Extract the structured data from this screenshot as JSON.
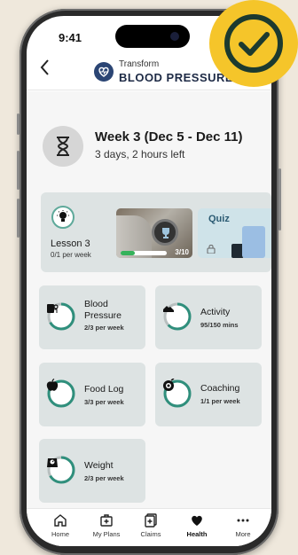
{
  "status_bar": {
    "time": "9:41"
  },
  "header": {
    "back_icon": "chevron-left-icon",
    "brand_small": "Transform",
    "brand_large": "BLOOD PRESSURE"
  },
  "week": {
    "title": "Week 3 (Dec 5 - Dec 11)",
    "subtitle": "3 days, 2 hours left",
    "icon": "hourglass-icon"
  },
  "lesson": {
    "title": "Lesson 3",
    "subtitle": "0/1 per week",
    "video_count": "3/10",
    "video_progress": 0.3,
    "quiz_label": "Quiz"
  },
  "tiles": [
    {
      "title": "Blood Pressure",
      "subtitle": "2/3 per week",
      "icon": "bp-cuff-icon",
      "progress": 0.67
    },
    {
      "title": "Activity",
      "subtitle": "95/150 mins",
      "icon": "sneaker-icon",
      "progress": 0.63
    },
    {
      "title": "Food Log",
      "subtitle": "3/3 per week",
      "icon": "apple-icon",
      "progress": 1.0
    },
    {
      "title": "Coaching",
      "subtitle": "1/1 per week",
      "icon": "coaching-icon",
      "progress": 1.0
    },
    {
      "title": "Weight",
      "subtitle": "2/3 per week",
      "icon": "scale-icon",
      "progress": 0.67
    }
  ],
  "tabs": [
    {
      "label": "Home",
      "icon": "home-icon"
    },
    {
      "label": "My Plans",
      "icon": "first-aid-icon"
    },
    {
      "label": "Claims",
      "icon": "claims-icon"
    },
    {
      "label": "Health",
      "icon": "heart-icon",
      "active": true
    },
    {
      "label": "More",
      "icon": "more-icon"
    }
  ],
  "colors": {
    "accent": "#2f8f7c",
    "badge": "#f5c52a",
    "brand": "#2b4574",
    "tile_bg": "#dde3e3"
  }
}
